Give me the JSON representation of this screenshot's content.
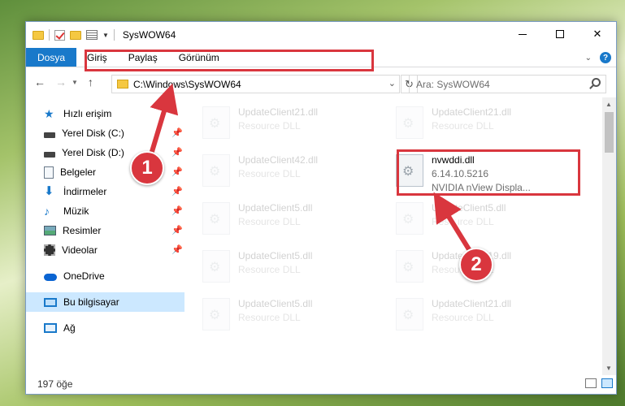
{
  "window": {
    "title": "SysWOW64"
  },
  "ribbon": {
    "tabs": [
      "Dosya",
      "Giriş",
      "Paylaş",
      "Görünüm"
    ]
  },
  "address": {
    "path": "C:\\Windows\\SysWOW64"
  },
  "search": {
    "placeholder": "Ara: SysWOW64"
  },
  "sidebar": {
    "items": [
      {
        "label": "Hızlı erişim",
        "icon": "star-icon"
      },
      {
        "label": "Yerel Disk (C:)",
        "icon": "disk-icon"
      },
      {
        "label": "Yerel Disk (D:)",
        "icon": "disk-icon"
      },
      {
        "label": "Belgeler",
        "icon": "document-icon"
      },
      {
        "label": "İndirmeler",
        "icon": "download-icon"
      },
      {
        "label": "Müzik",
        "icon": "music-icon"
      },
      {
        "label": "Resimler",
        "icon": "pictures-icon"
      },
      {
        "label": "Videolar",
        "icon": "video-icon"
      },
      {
        "label": "OneDrive",
        "icon": "cloud-icon"
      },
      {
        "label": "Bu bilgisayar",
        "icon": "computer-icon"
      },
      {
        "label": "Ağ",
        "icon": "network-icon"
      }
    ]
  },
  "files": [
    {
      "name": "UpdateClient21.dll",
      "meta1": "Resource DLL"
    },
    {
      "name": "UpdateClient21.dll",
      "meta1": "Resource DLL"
    },
    {
      "name": "UpdateClient42.dll",
      "meta1": "Resource DLL"
    },
    {
      "name": "nvwddi.dll",
      "meta1": "6.14.10.5216",
      "meta2": "NVIDIA nView Displa..."
    },
    {
      "name": "UpdateClient5.dll",
      "meta1": "Resource DLL"
    },
    {
      "name": "UpdateClient5.dll",
      "meta1": "Resource DLL"
    },
    {
      "name": "UpdateClient5.dll",
      "meta1": "Resource DLL"
    },
    {
      "name": "UpdateClient19.dll",
      "meta1": "Resource DLL"
    },
    {
      "name": "UpdateClient5.dll",
      "meta1": "Resource DLL"
    },
    {
      "name": "UpdateClient21.dll",
      "meta1": "Resource DLL"
    }
  ],
  "status": {
    "count": "197 öğe"
  },
  "callouts": {
    "one": "1",
    "two": "2"
  },
  "colors": {
    "accent": "#1979ca",
    "highlight": "#d9363e",
    "selected": "#cce8ff"
  }
}
